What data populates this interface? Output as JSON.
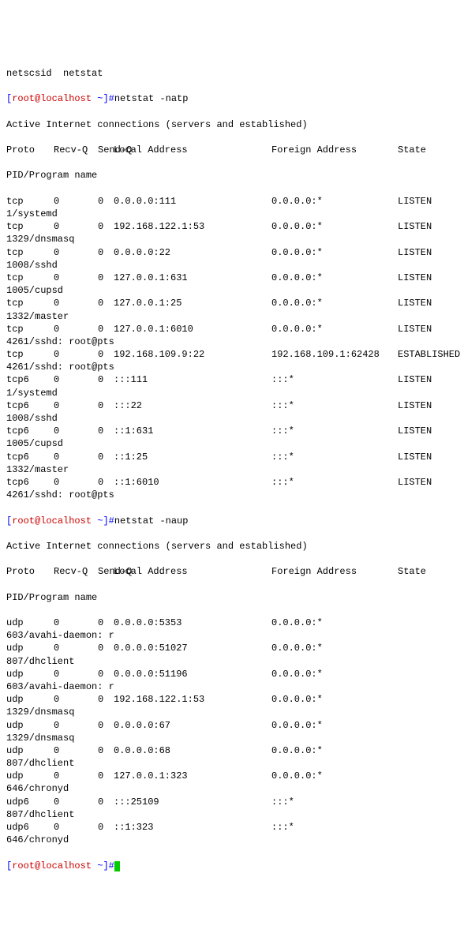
{
  "line_pre": "netscsid  netstat",
  "prompt_open": "[",
  "prompt_user": "root@localhost",
  "prompt_path": " ~",
  "prompt_close": "]#",
  "cmd1": "netstat -natp",
  "cmd2": "netstat -naup",
  "active_header": "Active Internet connections (servers and established)",
  "hdr_proto": "Proto",
  "hdr_recvq": "Recv-Q",
  "hdr_sendq": "Send-Q",
  "hdr_local": "Local Address",
  "hdr_foreign": "Foreign Address",
  "hdr_state": "State",
  "hdr_pidprog": "PID/Program name",
  "tcp": [
    {
      "proto": "tcp",
      "recvq": "0",
      "sendq": "0",
      "local": "0.0.0.0:111",
      "foreign": "0.0.0.0:*",
      "state": "LISTEN",
      "pidprog": "1/systemd"
    },
    {
      "proto": "tcp",
      "recvq": "0",
      "sendq": "0",
      "local": "192.168.122.1:53",
      "foreign": "0.0.0.0:*",
      "state": "LISTEN",
      "pidprog": "1329/dnsmasq"
    },
    {
      "proto": "tcp",
      "recvq": "0",
      "sendq": "0",
      "local": "0.0.0.0:22",
      "foreign": "0.0.0.0:*",
      "state": "LISTEN",
      "pidprog": "1008/sshd"
    },
    {
      "proto": "tcp",
      "recvq": "0",
      "sendq": "0",
      "local": "127.0.0.1:631",
      "foreign": "0.0.0.0:*",
      "state": "LISTEN",
      "pidprog": "1005/cupsd"
    },
    {
      "proto": "tcp",
      "recvq": "0",
      "sendq": "0",
      "local": "127.0.0.1:25",
      "foreign": "0.0.0.0:*",
      "state": "LISTEN",
      "pidprog": "1332/master"
    },
    {
      "proto": "tcp",
      "recvq": "0",
      "sendq": "0",
      "local": "127.0.0.1:6010",
      "foreign": "0.0.0.0:*",
      "state": "LISTEN",
      "pidprog": "4261/sshd: root@pts"
    },
    {
      "proto": "tcp",
      "recvq": "0",
      "sendq": "0",
      "local": "192.168.109.9:22",
      "foreign": "192.168.109.1:62428",
      "state": "ESTABLISHED",
      "pidprog": "4261/sshd: root@pts"
    },
    {
      "proto": "tcp6",
      "recvq": "0",
      "sendq": "0",
      "local": ":::111",
      "foreign": ":::*",
      "state": "LISTEN",
      "pidprog": "1/systemd"
    },
    {
      "proto": "tcp6",
      "recvq": "0",
      "sendq": "0",
      "local": ":::22",
      "foreign": ":::*",
      "state": "LISTEN",
      "pidprog": "1008/sshd"
    },
    {
      "proto": "tcp6",
      "recvq": "0",
      "sendq": "0",
      "local": "::1:631",
      "foreign": ":::*",
      "state": "LISTEN",
      "pidprog": "1005/cupsd"
    },
    {
      "proto": "tcp6",
      "recvq": "0",
      "sendq": "0",
      "local": "::1:25",
      "foreign": ":::*",
      "state": "LISTEN",
      "pidprog": "1332/master"
    },
    {
      "proto": "tcp6",
      "recvq": "0",
      "sendq": "0",
      "local": "::1:6010",
      "foreign": ":::*",
      "state": "LISTEN",
      "pidprog": "4261/sshd: root@pts"
    }
  ],
  "udp": [
    {
      "proto": "udp",
      "recvq": "0",
      "sendq": "0",
      "local": "0.0.0.0:5353",
      "foreign": "0.0.0.0:*",
      "state": "",
      "pidprog": "603/avahi-daemon: r"
    },
    {
      "proto": "udp",
      "recvq": "0",
      "sendq": "0",
      "local": "0.0.0.0:51027",
      "foreign": "0.0.0.0:*",
      "state": "",
      "pidprog": "807/dhclient"
    },
    {
      "proto": "udp",
      "recvq": "0",
      "sendq": "0",
      "local": "0.0.0.0:51196",
      "foreign": "0.0.0.0:*",
      "state": "",
      "pidprog": "603/avahi-daemon: r"
    },
    {
      "proto": "udp",
      "recvq": "0",
      "sendq": "0",
      "local": "192.168.122.1:53",
      "foreign": "0.0.0.0:*",
      "state": "",
      "pidprog": "1329/dnsmasq"
    },
    {
      "proto": "udp",
      "recvq": "0",
      "sendq": "0",
      "local": "0.0.0.0:67",
      "foreign": "0.0.0.0:*",
      "state": "",
      "pidprog": "1329/dnsmasq"
    },
    {
      "proto": "udp",
      "recvq": "0",
      "sendq": "0",
      "local": "0.0.0.0:68",
      "foreign": "0.0.0.0:*",
      "state": "",
      "pidprog": "807/dhclient"
    },
    {
      "proto": "udp",
      "recvq": "0",
      "sendq": "0",
      "local": "127.0.0.1:323",
      "foreign": "0.0.0.0:*",
      "state": "",
      "pidprog": "646/chronyd"
    },
    {
      "proto": "udp6",
      "recvq": "0",
      "sendq": "0",
      "local": ":::25109",
      "foreign": ":::*",
      "state": "",
      "pidprog": "807/dhclient"
    },
    {
      "proto": "udp6",
      "recvq": "0",
      "sendq": "0",
      "local": "::1:323",
      "foreign": ":::*",
      "state": "",
      "pidprog": "646/chronyd"
    }
  ]
}
